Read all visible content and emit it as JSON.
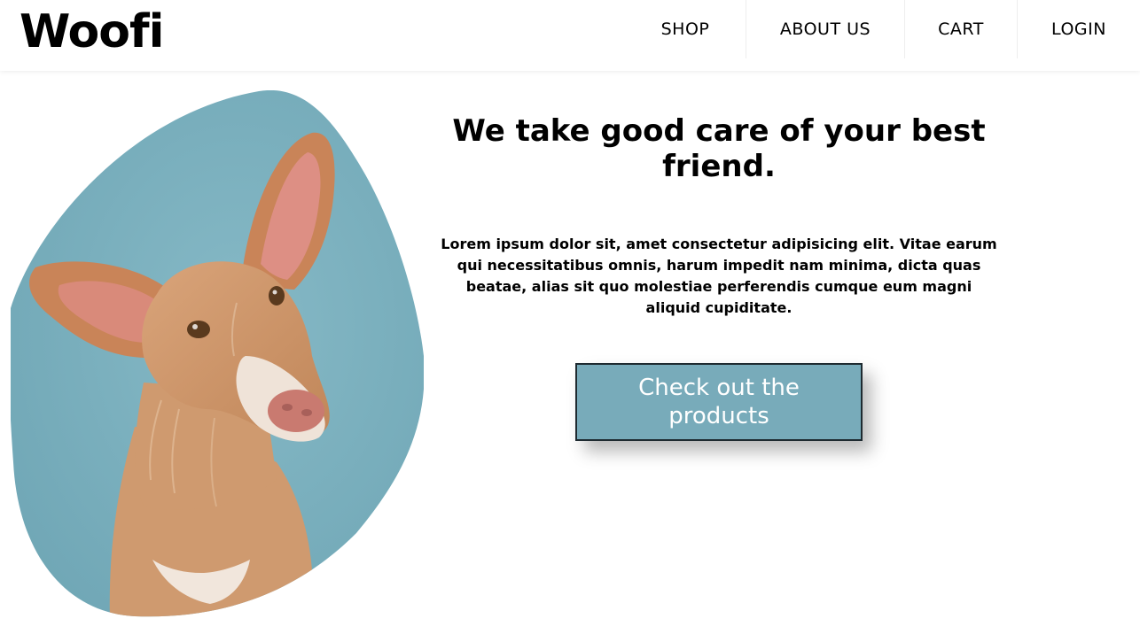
{
  "brand": {
    "name": "Woofi"
  },
  "nav": {
    "items": [
      {
        "label": "SHOP"
      },
      {
        "label": "ABOUT US"
      },
      {
        "label": "CART"
      },
      {
        "label": "LOGIN"
      }
    ]
  },
  "hero": {
    "image_icon": "dog-photo",
    "headline": "We take good care of your best friend.",
    "body": "Lorem ipsum dolor sit, amet consectetur adipisicing elit. Vitae earum qui necessitatibus omnis, harum impedit nam minima, dicta quas beatae, alias sit quo molestiae perferendis cumque eum magni aliquid cupiditate.",
    "cta_label": "Check out the products"
  },
  "colors": {
    "accent": "#78abba",
    "text": "#000000",
    "background": "#ffffff"
  }
}
